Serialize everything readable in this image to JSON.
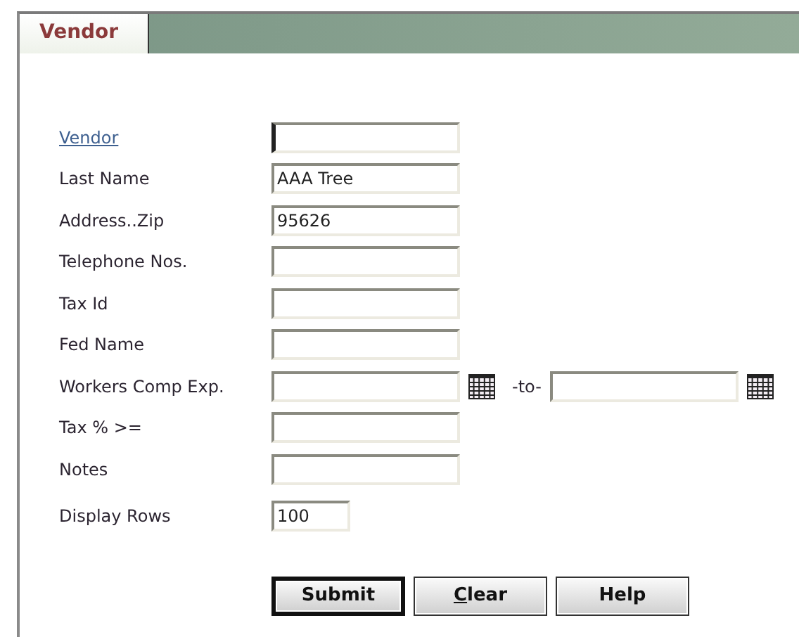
{
  "tab": {
    "label": "Vendor",
    "selected": true
  },
  "fields": [
    {
      "kind": "link",
      "label": "Vendor",
      "focused": true
    },
    {
      "kind": "text",
      "label": "Last Name",
      "value": "AAA Tree",
      "focused": false
    },
    {
      "kind": "text",
      "label": "Address..Zip",
      "value": "95626",
      "focused": false
    },
    {
      "kind": "text",
      "label": "Telephone Nos.",
      "focused": false
    },
    {
      "kind": "text",
      "label": "Tax Id",
      "focused": false
    },
    {
      "kind": "text",
      "label": "Fed Name",
      "focused": false
    },
    {
      "kind": "date_range",
      "label": "Workers Comp Exp.",
      "separator": "-to-",
      "focused": false
    },
    {
      "kind": "text",
      "label": "Tax % >=",
      "focused": false
    },
    {
      "kind": "text",
      "label": "Notes",
      "focused": false
    },
    {
      "kind": "short",
      "label": "Display Rows",
      "value": "100",
      "focused": false
    }
  ],
  "buttons": [
    {
      "label": "Submit",
      "default": true,
      "first_letter_underlined": false
    },
    {
      "label": "Clear",
      "default": false,
      "first_letter_underlined": true
    },
    {
      "label": "Help",
      "default": false,
      "first_letter_underlined": false
    }
  ]
}
